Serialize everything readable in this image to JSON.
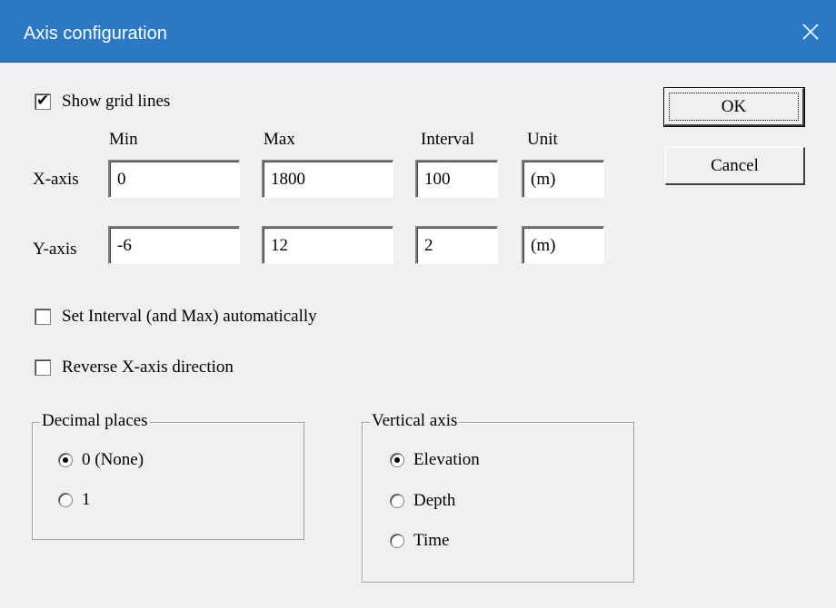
{
  "window": {
    "title": "Axis configuration"
  },
  "show_grid": {
    "label": "Show grid lines",
    "checked": true
  },
  "columns": {
    "min": "Min",
    "max": "Max",
    "interval": "Interval",
    "unit": "Unit"
  },
  "x_axis": {
    "label": "X-axis",
    "min": "0",
    "max": "1800",
    "interval": "100",
    "unit": "(m)"
  },
  "y_axis": {
    "label": "Y-axis",
    "min": "-6",
    "max": "12",
    "interval": "2",
    "unit": "(m)"
  },
  "auto_interval": {
    "label": "Set Interval (and Max) automatically",
    "checked": false
  },
  "reverse_x": {
    "label": "Reverse X-axis direction",
    "checked": false
  },
  "decimal_places": {
    "title": "Decimal places",
    "options": [
      {
        "label": "0 (None)",
        "selected": true
      },
      {
        "label": "1",
        "selected": false
      }
    ]
  },
  "vertical_axis": {
    "title": "Vertical axis",
    "options": [
      {
        "label": "Elevation",
        "selected": true
      },
      {
        "label": "Depth",
        "selected": false
      },
      {
        "label": "Time",
        "selected": false
      }
    ]
  },
  "buttons": {
    "ok": "OK",
    "cancel": "Cancel"
  },
  "icons": {
    "close": "close-icon"
  }
}
